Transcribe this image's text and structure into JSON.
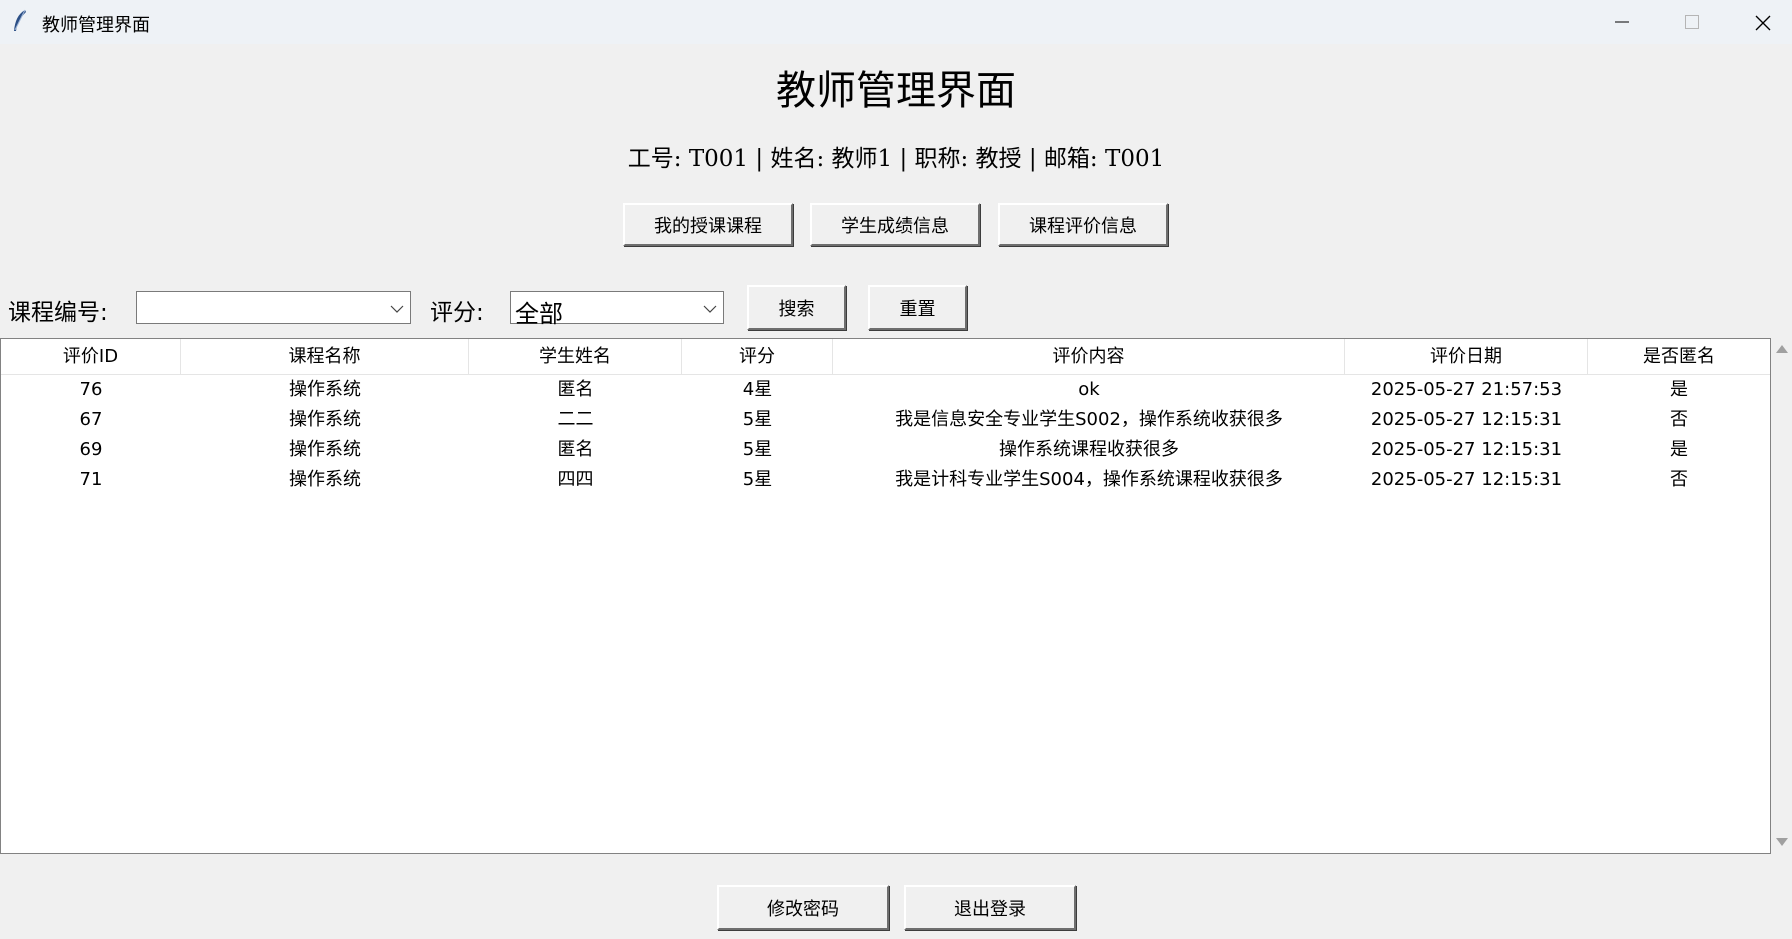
{
  "window": {
    "title": "教师管理界面",
    "icon": "feather-icon"
  },
  "header": {
    "title": "教师管理界面",
    "teacher_info": "工号: T001 | 姓名: 教师1 | 职称: 教授 | 邮箱: T001"
  },
  "nav": {
    "courses_label": "我的授课课程",
    "grades_label": "学生成绩信息",
    "reviews_label": "课程评价信息"
  },
  "search": {
    "course_label": "课程编号:",
    "course_value": "",
    "rating_label": "评分:",
    "rating_value": "全部",
    "search_label": "搜索",
    "reset_label": "重置"
  },
  "table": {
    "columns": [
      "评价ID",
      "课程名称",
      "学生姓名",
      "评分",
      "评价内容",
      "评价日期",
      "是否匿名"
    ],
    "rows": [
      [
        "76",
        "操作系统",
        "匿名",
        "4星",
        "ok",
        "2025-05-27 21:57:53",
        "是"
      ],
      [
        "67",
        "操作系统",
        "二二",
        "5星",
        "我是信息安全专业学生S002，操作系统收获很多",
        "2025-05-27 12:15:31",
        "否"
      ],
      [
        "69",
        "操作系统",
        "匿名",
        "5星",
        "操作系统课程收获很多",
        "2025-05-27 12:15:31",
        "是"
      ],
      [
        "71",
        "操作系统",
        "四四",
        "5星",
        "我是计科专业学生S004，操作系统课程收获很多",
        "2025-05-27 12:15:31",
        "否"
      ]
    ]
  },
  "footer": {
    "change_password_label": "修改密码",
    "logout_label": "退出登录"
  }
}
